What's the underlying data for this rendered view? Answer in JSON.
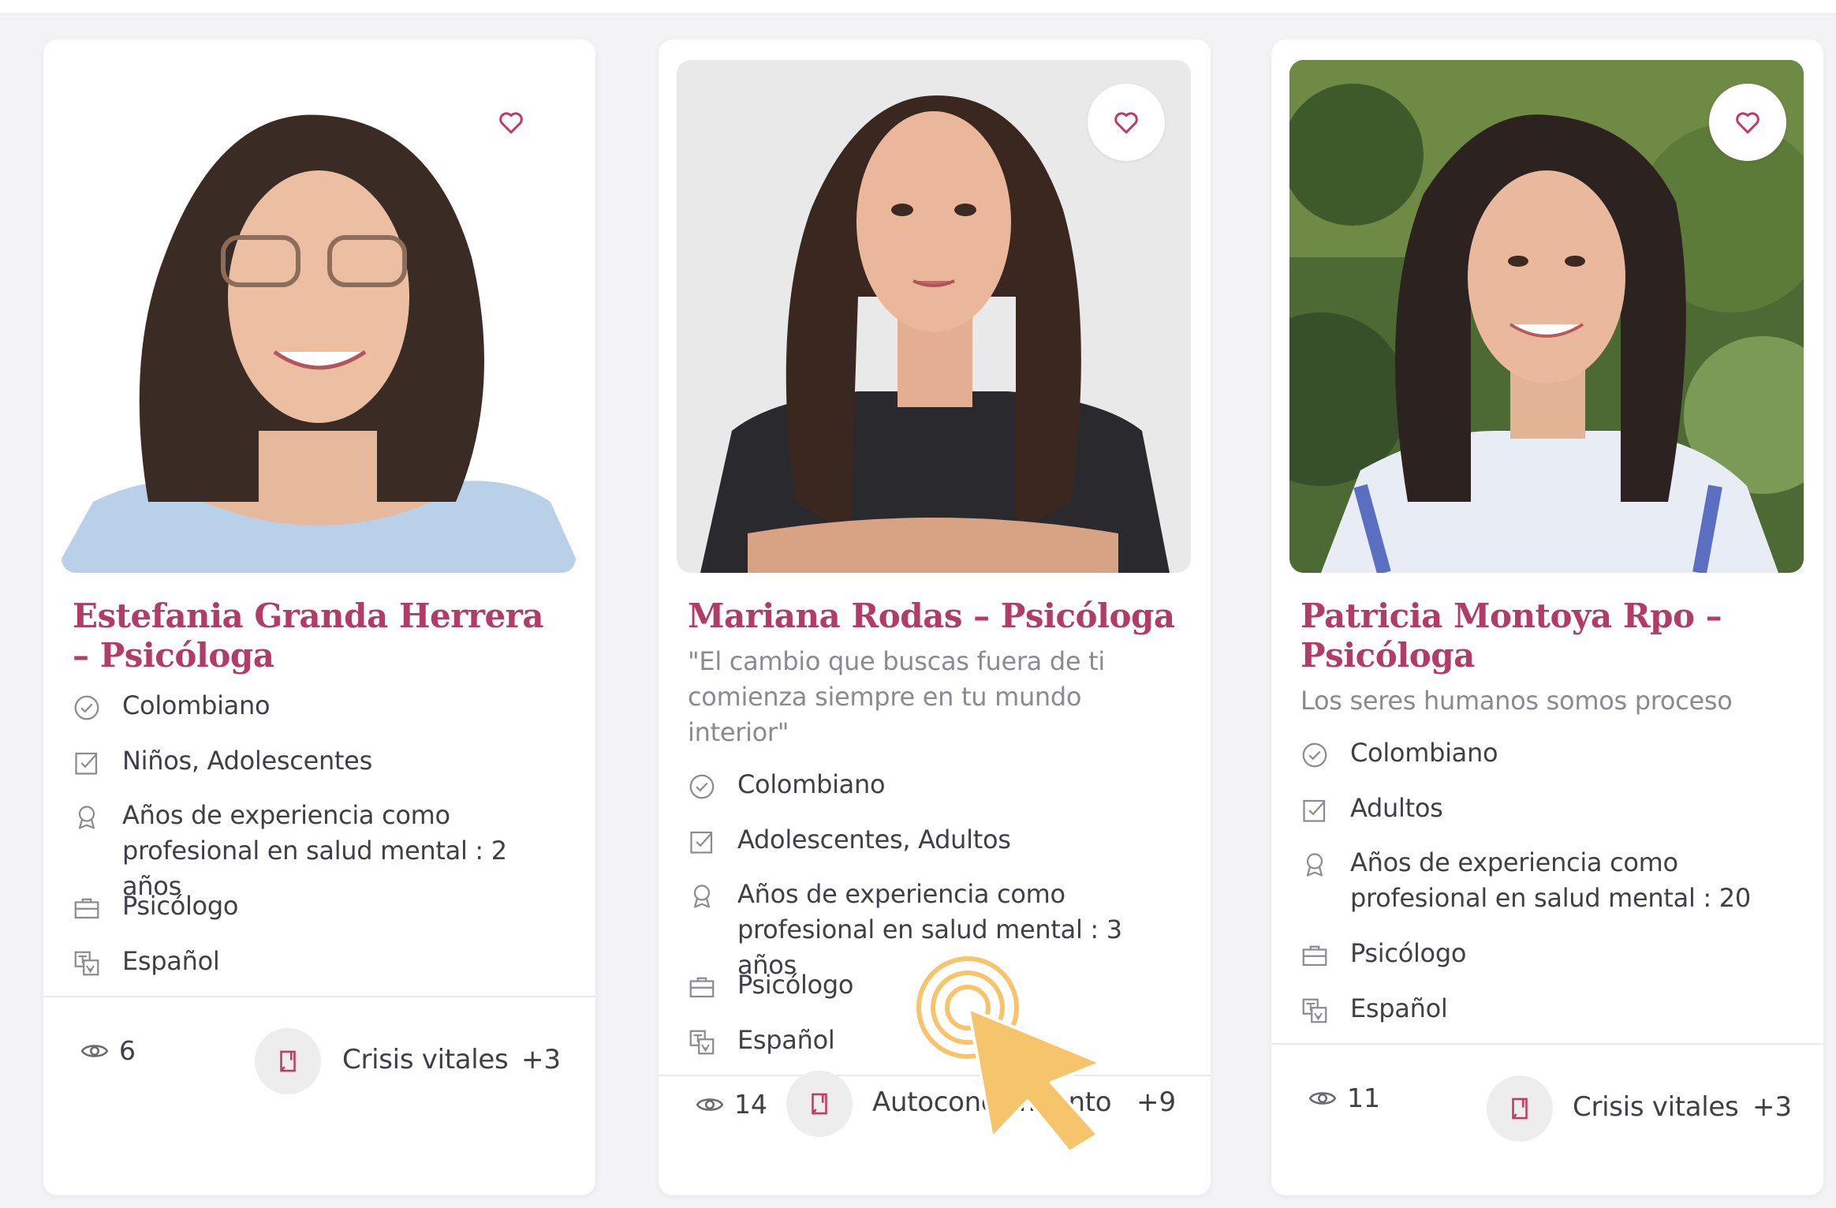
{
  "colors": {
    "accent": "#b23c68",
    "heart": "#c23a62",
    "icon": "#8c8b94",
    "cursor": "#f6c46a"
  },
  "cards": [
    {
      "name": "Estefania Granda Herrera – Psicóloga",
      "quote": "",
      "attributes": [
        {
          "icon": "check-circle-icon",
          "text": "Colombiano"
        },
        {
          "icon": "checkbox-icon",
          "text": "Niños, Adolescentes"
        },
        {
          "icon": "award-icon",
          "text": "Años de experiencia como profesional en salud mental : 2 años"
        },
        {
          "icon": "briefcase-icon",
          "text": "Psicólogo"
        },
        {
          "icon": "translate-icon",
          "text": "Español"
        }
      ],
      "views": "6",
      "tag": "Crisis vitales",
      "more": "+3"
    },
    {
      "name": "Mariana Rodas – Psicóloga",
      "quote": "\"El cambio que buscas fuera de ti comienza siempre en tu mundo interior\"",
      "attributes": [
        {
          "icon": "check-circle-icon",
          "text": "Colombiano"
        },
        {
          "icon": "checkbox-icon",
          "text": "Adolescentes, Adultos"
        },
        {
          "icon": "award-icon",
          "text": "Años de experiencia como profesional en salud mental : 3 años"
        },
        {
          "icon": "briefcase-icon",
          "text": "Psicólogo"
        },
        {
          "icon": "translate-icon",
          "text": "Español"
        }
      ],
      "views": "14",
      "tag": "Autoconocimiento",
      "more": "+9"
    },
    {
      "name": "Patricia Montoya Rpo – Psicóloga",
      "quote": "Los seres humanos somos proceso",
      "attributes": [
        {
          "icon": "check-circle-icon",
          "text": "Colombiano"
        },
        {
          "icon": "checkbox-icon",
          "text": "Adultos"
        },
        {
          "icon": "award-icon",
          "text": "Años de experiencia como profesional en salud mental : 20"
        },
        {
          "icon": "briefcase-icon",
          "text": "Psicólogo"
        },
        {
          "icon": "translate-icon",
          "text": "Español"
        }
      ],
      "views": "11",
      "tag": "Crisis vitales",
      "more": "+3"
    }
  ]
}
